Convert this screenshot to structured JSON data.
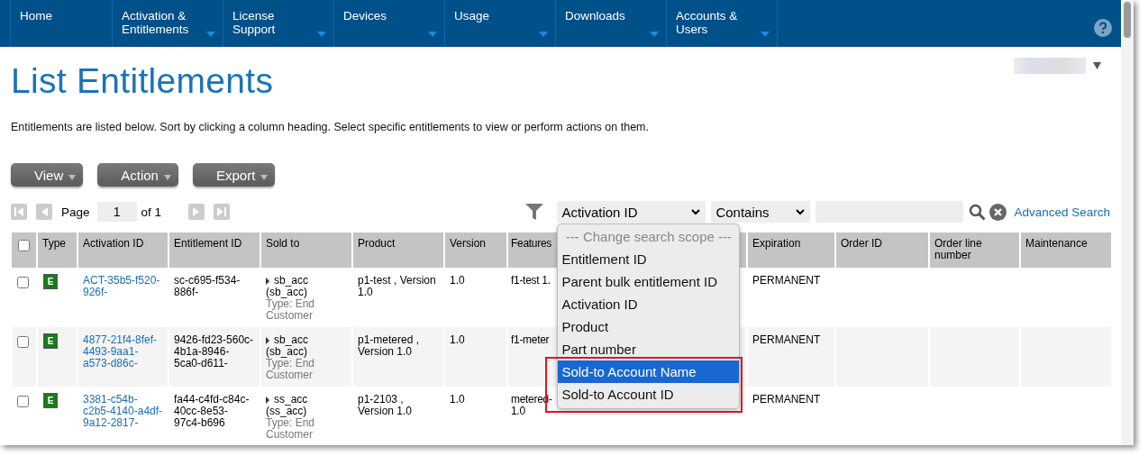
{
  "nav": [
    {
      "label": "Home",
      "has_menu": false
    },
    {
      "label": "Activation & Entitlements",
      "has_menu": true
    },
    {
      "label": "License Support",
      "has_menu": true
    },
    {
      "label": "Devices",
      "has_menu": true
    },
    {
      "label": "Usage",
      "has_menu": true
    },
    {
      "label": "Downloads",
      "has_menu": true
    },
    {
      "label": "Accounts & Users",
      "has_menu": true
    }
  ],
  "title": "List Entitlements",
  "description": "Entitlements are listed below. Sort by clicking a column heading. Select specific entitlements to view or perform actions on them.",
  "action_buttons": [
    "View",
    "Action",
    "Export"
  ],
  "pager": {
    "label": "Page",
    "page": "1",
    "of": "of 1"
  },
  "search": {
    "scope": "Activation ID",
    "operator": "Contains",
    "link": "Advanced Search"
  },
  "scope_menu": [
    {
      "label": "--- Change search scope ---",
      "kind": "header",
      "selected": false
    },
    {
      "label": "Entitlement ID",
      "kind": "option",
      "selected": false
    },
    {
      "label": "Parent bulk entitlement ID",
      "kind": "option",
      "selected": false
    },
    {
      "label": "Activation ID",
      "kind": "option",
      "selected": false
    },
    {
      "label": "Product",
      "kind": "option",
      "selected": false
    },
    {
      "label": "Part number",
      "kind": "option",
      "selected": false
    },
    {
      "label": "Sold-to Account Name",
      "kind": "option",
      "selected": true
    },
    {
      "label": "Sold-to Account ID",
      "kind": "option",
      "selected": false
    }
  ],
  "table": {
    "select_all_checked": false,
    "columns": [
      "Type",
      "Activation ID",
      "Entitlement ID",
      "Sold to",
      "Product",
      "Version",
      "Features",
      "Expiration",
      "Order ID",
      "Order line number",
      "Maintenance"
    ],
    "rows": [
      {
        "checked": false,
        "type": "E",
        "activation_id": "ACT-35b5-f520-926f-",
        "entitlement_id": "sc-c695-f534-886f-",
        "sold_to": "sb_acc",
        "sold_to_id": "(sb_acc)",
        "sold_to_type": "Type: End Customer",
        "product": "p1-test , Version 1.0",
        "version": "1.0",
        "features": "f1-test 1.",
        "expiration": "PERMANENT"
      },
      {
        "checked": false,
        "type": "E",
        "activation_id": "4877-21f4-8fef-4493-9aa1-a573-d86c-",
        "entitlement_id": "9426-fd23-560c-4b1a-8946-5ca0-d611-",
        "sold_to": "sb_acc",
        "sold_to_id": "(sb_acc)",
        "sold_to_type": "Type: End Customer",
        "product": "p1-metered , Version 1.0",
        "version": "1.0",
        "features": "f1-meter",
        "expiration": "PERMANENT"
      },
      {
        "checked": false,
        "type": "E",
        "activation_id": "3381-c54b-c2b5-4140-a4df-9a12-2817-",
        "entitlement_id": "fa44-c4fd-c84c-40cc-8e53-97c4-b696",
        "sold_to": "ss_acc",
        "sold_to_id": "(ss_acc)",
        "sold_to_type": "Type: End Customer",
        "product": "p1-2103 , Version 1.0",
        "version": "1.0",
        "features": "metered- 1.0",
        "expiration": "PERMANENT"
      }
    ]
  }
}
